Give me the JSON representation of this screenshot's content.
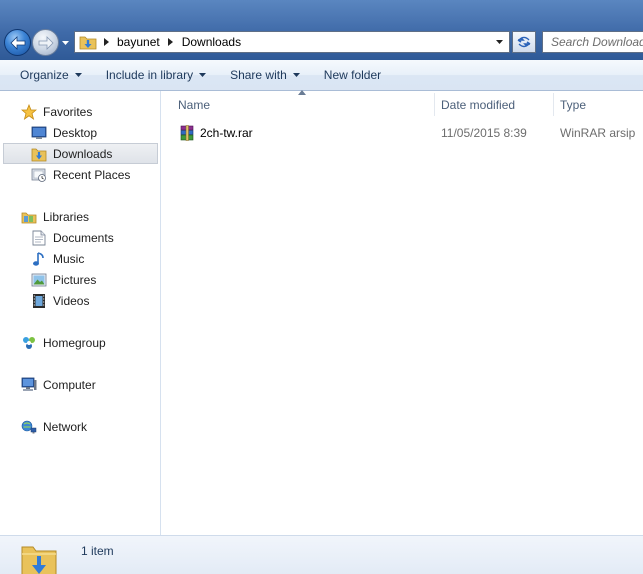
{
  "breadcrumb": {
    "items": [
      "bayunet",
      "Downloads"
    ]
  },
  "search": {
    "placeholder": "Search Downloads"
  },
  "toolbar": {
    "organize": "Organize",
    "include_in_library": "Include in library",
    "share_with": "Share with",
    "new_folder": "New folder"
  },
  "navigation": {
    "favorites": {
      "label": "Favorites",
      "icon": "star-icon",
      "items": [
        {
          "label": "Desktop",
          "icon": "desktop-icon"
        },
        {
          "label": "Downloads",
          "icon": "downloads-folder-icon",
          "selected": true
        },
        {
          "label": "Recent Places",
          "icon": "recent-places-icon"
        }
      ]
    },
    "libraries": {
      "label": "Libraries",
      "icon": "libraries-icon",
      "items": [
        {
          "label": "Documents",
          "icon": "documents-icon"
        },
        {
          "label": "Music",
          "icon": "music-icon"
        },
        {
          "label": "Pictures",
          "icon": "pictures-icon"
        },
        {
          "label": "Videos",
          "icon": "videos-icon"
        }
      ]
    },
    "homegroup": {
      "label": "Homegroup",
      "icon": "homegroup-icon"
    },
    "computer": {
      "label": "Computer",
      "icon": "computer-icon"
    },
    "network": {
      "label": "Network",
      "icon": "network-icon"
    }
  },
  "columns": {
    "name": "Name",
    "date_modified": "Date modified",
    "type": "Type"
  },
  "files": [
    {
      "name": "2ch-tw.rar",
      "date_modified": "11/05/2015 8:39",
      "type": "WinRAR arsip",
      "icon": "winrar-archive-icon"
    }
  ],
  "status": {
    "item_count": "1 item"
  },
  "colors": {
    "titlebar": "#3f6aa8",
    "command_text": "#1e395b",
    "header_text": "#4c607a",
    "secondary_text": "#6d6d6d"
  }
}
